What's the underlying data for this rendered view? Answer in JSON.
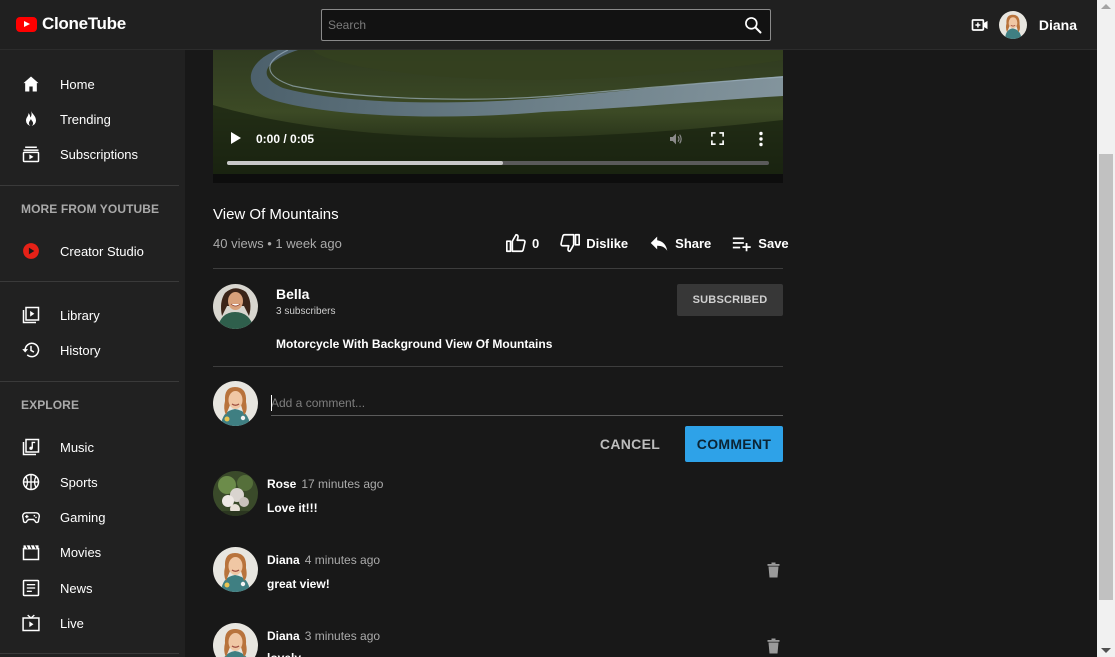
{
  "app": {
    "name": "CloneTube"
  },
  "header": {
    "search_placeholder": "Search",
    "user_name": "Diana"
  },
  "sidebar": {
    "main_items": [
      {
        "label": "Home",
        "icon": "home-icon"
      },
      {
        "label": "Trending",
        "icon": "flame-icon"
      },
      {
        "label": "Subscriptions",
        "icon": "subscriptions-icon"
      }
    ],
    "more_label": "MORE FROM YOUTUBE",
    "more_items": [
      {
        "label": "Creator Studio",
        "icon": "youtube-red-icon"
      }
    ],
    "library_items": [
      {
        "label": "Library",
        "icon": "library-icon"
      },
      {
        "label": "History",
        "icon": "history-icon"
      }
    ],
    "explore_label": "EXPLORE",
    "explore_items": [
      {
        "label": "Music",
        "icon": "music-icon"
      },
      {
        "label": "Sports",
        "icon": "sports-icon"
      },
      {
        "label": "Gaming",
        "icon": "gaming-icon"
      },
      {
        "label": "Movies",
        "icon": "movies-icon"
      },
      {
        "label": "News",
        "icon": "news-icon"
      },
      {
        "label": "Live",
        "icon": "live-icon"
      }
    ]
  },
  "player": {
    "time": "0:00 / 0:05",
    "progress": 0.51
  },
  "video": {
    "title": "View Of Mountains",
    "meta": "40 views • 1 week ago",
    "likes": "0",
    "dislike_label": "Dislike",
    "share_label": "Share",
    "save_label": "Save"
  },
  "channel": {
    "name": "Bella",
    "subscribers": "3 subscribers",
    "subscribe_label": "SUBSCRIBED",
    "description": "Motorcycle With Background View Of Mountains"
  },
  "comment_form": {
    "placeholder": "Add a comment...",
    "cancel_label": "CANCEL",
    "submit_label": "COMMENT"
  },
  "comments": [
    {
      "author": "Rose",
      "time": "17 minutes ago",
      "text": "Love it!!!",
      "deletable": false
    },
    {
      "author": "Diana",
      "time": "4 minutes ago",
      "text": "great view!",
      "deletable": true
    },
    {
      "author": "Diana",
      "time": "3 minutes ago",
      "text": "lovely",
      "deletable": true
    }
  ],
  "colors": {
    "accent": "#2ea2e8",
    "logo": "#ff0000",
    "background": "#181818",
    "sidebar": "#212121"
  }
}
